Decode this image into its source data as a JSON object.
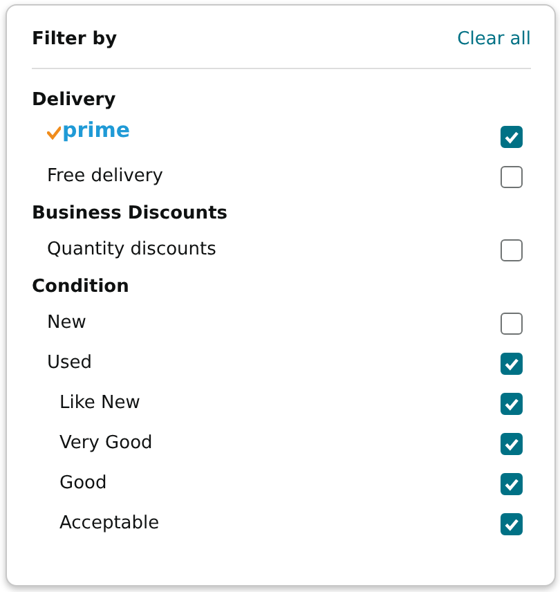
{
  "panel": {
    "title": "Filter by",
    "clear_link": "Clear all"
  },
  "sections": [
    {
      "heading": "Delivery",
      "items": [
        {
          "kind": "logo",
          "label": "prime",
          "checked": true
        },
        {
          "kind": "text",
          "label": "Free delivery",
          "checked": false
        }
      ]
    },
    {
      "heading": "Business Discounts",
      "items": [
        {
          "kind": "text",
          "label": "Quantity discounts",
          "checked": false
        }
      ]
    },
    {
      "heading": "Condition",
      "items": [
        {
          "kind": "text",
          "label": "New",
          "checked": false
        },
        {
          "kind": "text",
          "label": "Used",
          "checked": true,
          "children": [
            {
              "kind": "text",
              "label": "Like New",
              "checked": true
            },
            {
              "kind": "text",
              "label": "Very Good",
              "checked": true
            },
            {
              "kind": "text",
              "label": "Good",
              "checked": true
            },
            {
              "kind": "text",
              "label": "Acceptable",
              "checked": true
            }
          ]
        }
      ]
    }
  ]
}
